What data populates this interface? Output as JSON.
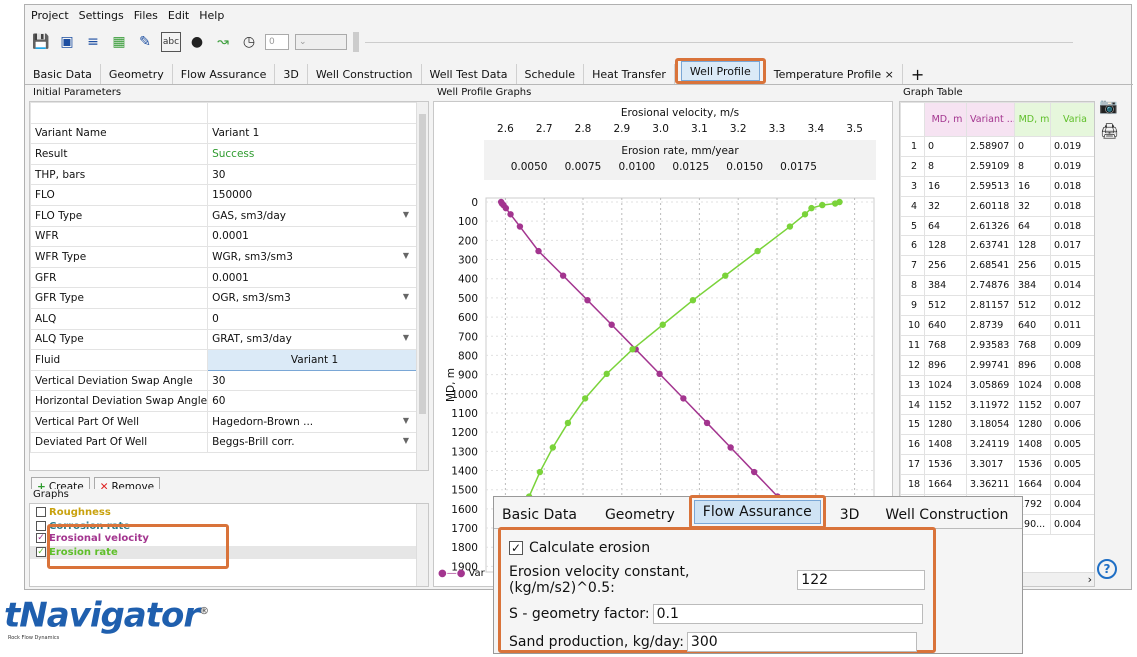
{
  "menu": [
    "Project",
    "Settings",
    "Files",
    "Edit",
    "Help"
  ],
  "toolbar": {
    "spin_value": "0"
  },
  "tabs": [
    "Basic Data",
    "Geometry",
    "Flow Assurance",
    "3D",
    "Well Construction",
    "Well Test Data",
    "Schedule",
    "Heat Transfer",
    "Well Profile",
    "Temperature Profile ×"
  ],
  "tab_add": "+",
  "left_panel": {
    "title": "Initial Parameters",
    "rows": [
      {
        "label": "Variant Name",
        "value": "Variant 1"
      },
      {
        "label": "Result",
        "value": "Success"
      },
      {
        "label": "THP, bars",
        "value": "30"
      },
      {
        "label": "FLO",
        "value": "150000"
      },
      {
        "label": "FLO Type",
        "value": "GAS, sm3/day"
      },
      {
        "label": "WFR",
        "value": "0.0001"
      },
      {
        "label": "WFR Type",
        "value": "WGR, sm3/sm3"
      },
      {
        "label": "GFR",
        "value": "0.0001"
      },
      {
        "label": "GFR Type",
        "value": "OGR, sm3/sm3"
      },
      {
        "label": "ALQ",
        "value": "0"
      },
      {
        "label": "ALQ Type",
        "value": "GRAT, sm3/day"
      },
      {
        "label": "Fluid",
        "value": "Variant 1"
      },
      {
        "label": "Vertical Deviation Swap Angle",
        "value": "30"
      },
      {
        "label": "Horizontal Deviation Swap Angle",
        "value": "60"
      },
      {
        "label": "Vertical Part Of Well",
        "value": "Hagedorn-Brown ..."
      },
      {
        "label": "Deviated Part Of Well",
        "value": "Beggs-Brill corr."
      }
    ],
    "create_label": "Create",
    "remove_label": "Remove"
  },
  "graphs_panel": {
    "title": "Graphs",
    "items": [
      "Roughness",
      "Corrosion rate",
      "Erosional velocity",
      "Erosion rate"
    ]
  },
  "chart_panel": {
    "title": "Well Profile Graphs",
    "legend_partial": "Var"
  },
  "chart_data": {
    "type": "line",
    "top_axis1_label": "Erosional velocity, m/s",
    "top_axis1_ticks": [
      "2.6",
      "2.7",
      "2.8",
      "2.9",
      "3.0",
      "3.1",
      "3.2",
      "3.3",
      "3.4",
      "3.5"
    ],
    "top_axis2_label": "Erosion rate, mm/year",
    "top_axis2_ticks": [
      "0.0050",
      "0.0075",
      "0.0100",
      "0.0125",
      "0.0150",
      "0.0175"
    ],
    "ylabel": "MD, m",
    "y_ticks": [
      "0",
      "100",
      "200",
      "300",
      "400",
      "500",
      "600",
      "700",
      "800",
      "900",
      "1000",
      "1100",
      "1200",
      "1300",
      "1400",
      "1500",
      "1600",
      "1700",
      "1800",
      "1900"
    ],
    "xlim1": [
      2.55,
      3.55
    ],
    "xlim2": [
      0.003,
      0.021
    ],
    "ylim": [
      0,
      1950
    ],
    "series": [
      {
        "name": "Erosional velocity",
        "color": "#a3358f",
        "md": [
          0,
          8,
          16,
          32,
          64,
          128,
          256,
          384,
          512,
          640,
          768,
          896,
          1024,
          1152,
          1280,
          1408,
          1536,
          1664
        ],
        "values": [
          2.58907,
          2.59109,
          2.59513,
          2.60118,
          2.61326,
          2.63741,
          2.68541,
          2.74876,
          2.81157,
          2.8739,
          2.93583,
          2.99741,
          3.05869,
          3.11972,
          3.18054,
          3.24119,
          3.3017,
          3.36211
        ]
      },
      {
        "name": "Erosion rate",
        "color": "#7ad33a",
        "md": [
          0,
          8,
          16,
          32,
          64,
          128,
          256,
          384,
          512,
          640,
          768,
          896,
          1024,
          1152,
          1280,
          1408,
          1536,
          1664
        ],
        "values": [
          0.0194,
          0.0192,
          0.0186,
          0.0181,
          0.0178,
          0.0171,
          0.0156,
          0.0141,
          0.0126,
          0.0112,
          0.0098,
          0.0086,
          0.0076,
          0.0068,
          0.0061,
          0.0055,
          0.005,
          0.0045
        ]
      }
    ]
  },
  "graph_table": {
    "title": "Graph Table",
    "headers": [
      "MD, m",
      "Variant ... m/s",
      "MD, m",
      "Varia"
    ],
    "rows": [
      [
        "1",
        "0",
        "2.58907",
        "0",
        "0.019"
      ],
      [
        "2",
        "8",
        "2.59109",
        "8",
        "0.019"
      ],
      [
        "3",
        "16",
        "2.59513",
        "16",
        "0.018"
      ],
      [
        "4",
        "32",
        "2.60118",
        "32",
        "0.018"
      ],
      [
        "5",
        "64",
        "2.61326",
        "64",
        "0.018"
      ],
      [
        "6",
        "128",
        "2.63741",
        "128",
        "0.017"
      ],
      [
        "7",
        "256",
        "2.68541",
        "256",
        "0.015"
      ],
      [
        "8",
        "384",
        "2.74876",
        "384",
        "0.014"
      ],
      [
        "9",
        "512",
        "2.81157",
        "512",
        "0.012"
      ],
      [
        "10",
        "640",
        "2.8739",
        "640",
        "0.011"
      ],
      [
        "11",
        "768",
        "2.93583",
        "768",
        "0.009"
      ],
      [
        "12",
        "896",
        "2.99741",
        "896",
        "0.008"
      ],
      [
        "13",
        "1024",
        "3.05869",
        "1024",
        "0.008"
      ],
      [
        "14",
        "1152",
        "3.11972",
        "1152",
        "0.007"
      ],
      [
        "15",
        "1280",
        "3.18054",
        "1280",
        "0.006"
      ],
      [
        "16",
        "1408",
        "3.24119",
        "1408",
        "0.005"
      ],
      [
        "17",
        "1536",
        "3.3017",
        "1536",
        "0.005"
      ],
      [
        "18",
        "1664",
        "3.36211",
        "1664",
        "0.004"
      ],
      [
        "19",
        "",
        "",
        "1792",
        "0.004"
      ],
      [
        "20",
        "",
        "",
        "190...",
        "0.004"
      ]
    ]
  },
  "popup": {
    "tabs": [
      "Basic Data",
      "Geometry",
      "Flow Assurance",
      "3D",
      "Well Construction"
    ],
    "checkbox_label": "Calculate erosion",
    "fields": [
      {
        "label": "Erosion velocity constant, (kg/m/s2)^0.5:",
        "value": "122"
      },
      {
        "label": "S - geometry factor:",
        "value": "0.1"
      },
      {
        "label": "Sand production, kg/day:",
        "value": "300"
      }
    ]
  },
  "logo": {
    "name": "tNavigator",
    "reg": "®",
    "tagline": "Rock Flow Dynamics"
  }
}
